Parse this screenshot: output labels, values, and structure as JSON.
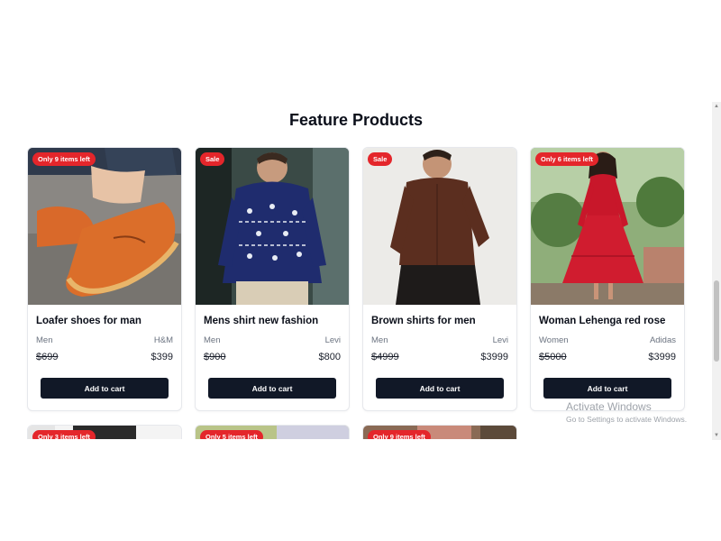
{
  "section_title": "Feature Products",
  "button_label": "Add to cart",
  "products": [
    {
      "badge": "Only 9 items left",
      "name": "Loafer shoes for man",
      "category": "Men",
      "brand": "H&M",
      "old_price": "$699",
      "price": "$399",
      "image": "orange-loafer-shoe-image"
    },
    {
      "badge": "Sale",
      "name": "Mens shirt new fashion",
      "category": "Men",
      "brand": "Levi",
      "old_price": "$900",
      "price": "$800",
      "image": "navy-printed-shirt-image"
    },
    {
      "badge": "Sale",
      "name": "Brown shirts for men",
      "category": "Men",
      "brand": "Levi",
      "old_price": "$4999",
      "price": "$3999",
      "image": "brown-shirt-image"
    },
    {
      "badge": "Only 6 items left",
      "name": "Woman Lehenga red rose",
      "category": "Women",
      "brand": "Adidas",
      "old_price": "$5000",
      "price": "$3999",
      "image": "red-dress-image"
    }
  ],
  "next_row_badges": [
    "Only 3 items left",
    "Only 5 items left",
    "Only 9 items left"
  ],
  "watermark": {
    "line1": "Activate Windows",
    "line2": "Go to Settings to activate Windows."
  },
  "colors": {
    "badge": "#e4262b",
    "button": "#111827",
    "title": "#0b0f1a",
    "muted": "#6b7380"
  }
}
